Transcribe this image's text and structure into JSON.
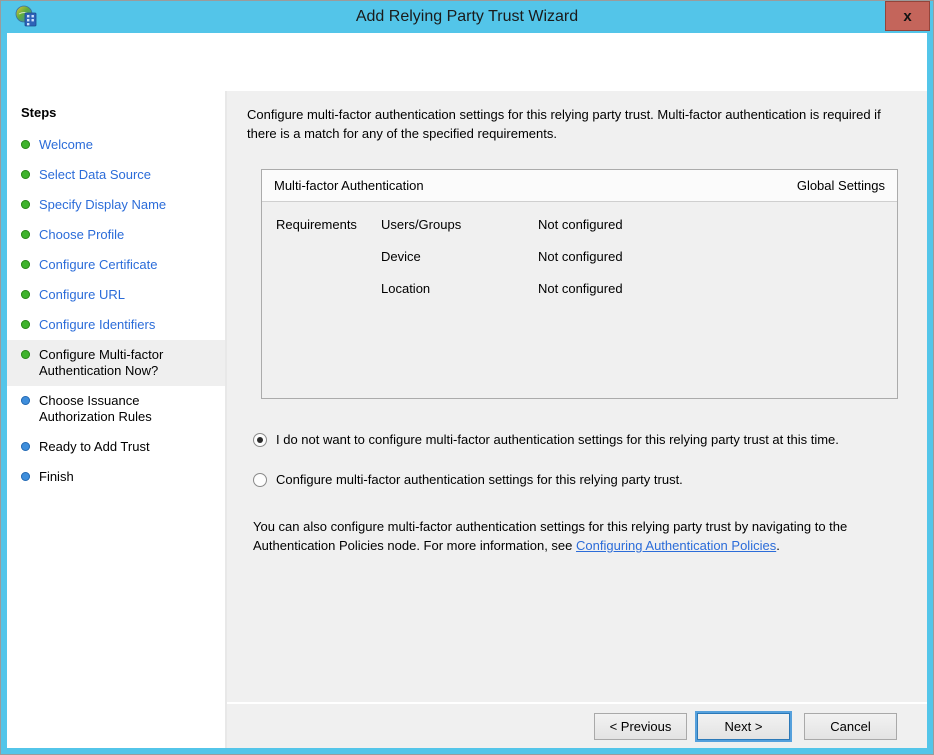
{
  "window": {
    "title": "Add Relying Party Trust Wizard",
    "close_label": "x"
  },
  "sidebar": {
    "header": "Steps",
    "items": [
      {
        "label": "Welcome",
        "state": "done"
      },
      {
        "label": "Select Data Source",
        "state": "done"
      },
      {
        "label": "Specify Display Name",
        "state": "done"
      },
      {
        "label": "Choose Profile",
        "state": "done"
      },
      {
        "label": "Configure Certificate",
        "state": "done"
      },
      {
        "label": "Configure URL",
        "state": "done"
      },
      {
        "label": "Configure Identifiers",
        "state": "done"
      },
      {
        "label": "Configure Multi-factor Authentication Now?",
        "state": "current"
      },
      {
        "label": "Choose Issuance Authorization Rules",
        "state": "upcoming"
      },
      {
        "label": "Ready to Add Trust",
        "state": "upcoming"
      },
      {
        "label": "Finish",
        "state": "upcoming"
      }
    ]
  },
  "content": {
    "intro": "Configure multi-factor authentication settings for this relying party trust. Multi-factor authentication is required if there is a match for any of the specified requirements.",
    "panel": {
      "header_left": "Multi-factor Authentication",
      "header_right": "Global Settings",
      "row_label": "Requirements",
      "rows": [
        {
          "name": "Users/Groups",
          "value": "Not configured"
        },
        {
          "name": "Device",
          "value": "Not configured"
        },
        {
          "name": "Location",
          "value": "Not configured"
        }
      ]
    },
    "radios": [
      {
        "label": "I do not want to configure multi-factor authentication settings for this relying party trust at this time.",
        "selected": true
      },
      {
        "label": "Configure multi-factor authentication settings for this relying party trust.",
        "selected": false
      }
    ],
    "footer_text_before": "You can also configure multi-factor authentication settings for this relying party trust by navigating to the Authentication Policies node. For more information, see ",
    "footer_link": "Configuring Authentication Policies",
    "footer_text_after": "."
  },
  "buttons": {
    "previous": "< Previous",
    "next": "Next >",
    "cancel": "Cancel"
  },
  "colors": {
    "titlebar_blue": "#53C5E9",
    "close_button_red": "#C4655B",
    "link_blue": "#2B6CD9",
    "content_bg": "#F0F0F0",
    "done_bullet_green": "#3FB32C",
    "upcoming_bullet_blue": "#3E8EDC"
  }
}
